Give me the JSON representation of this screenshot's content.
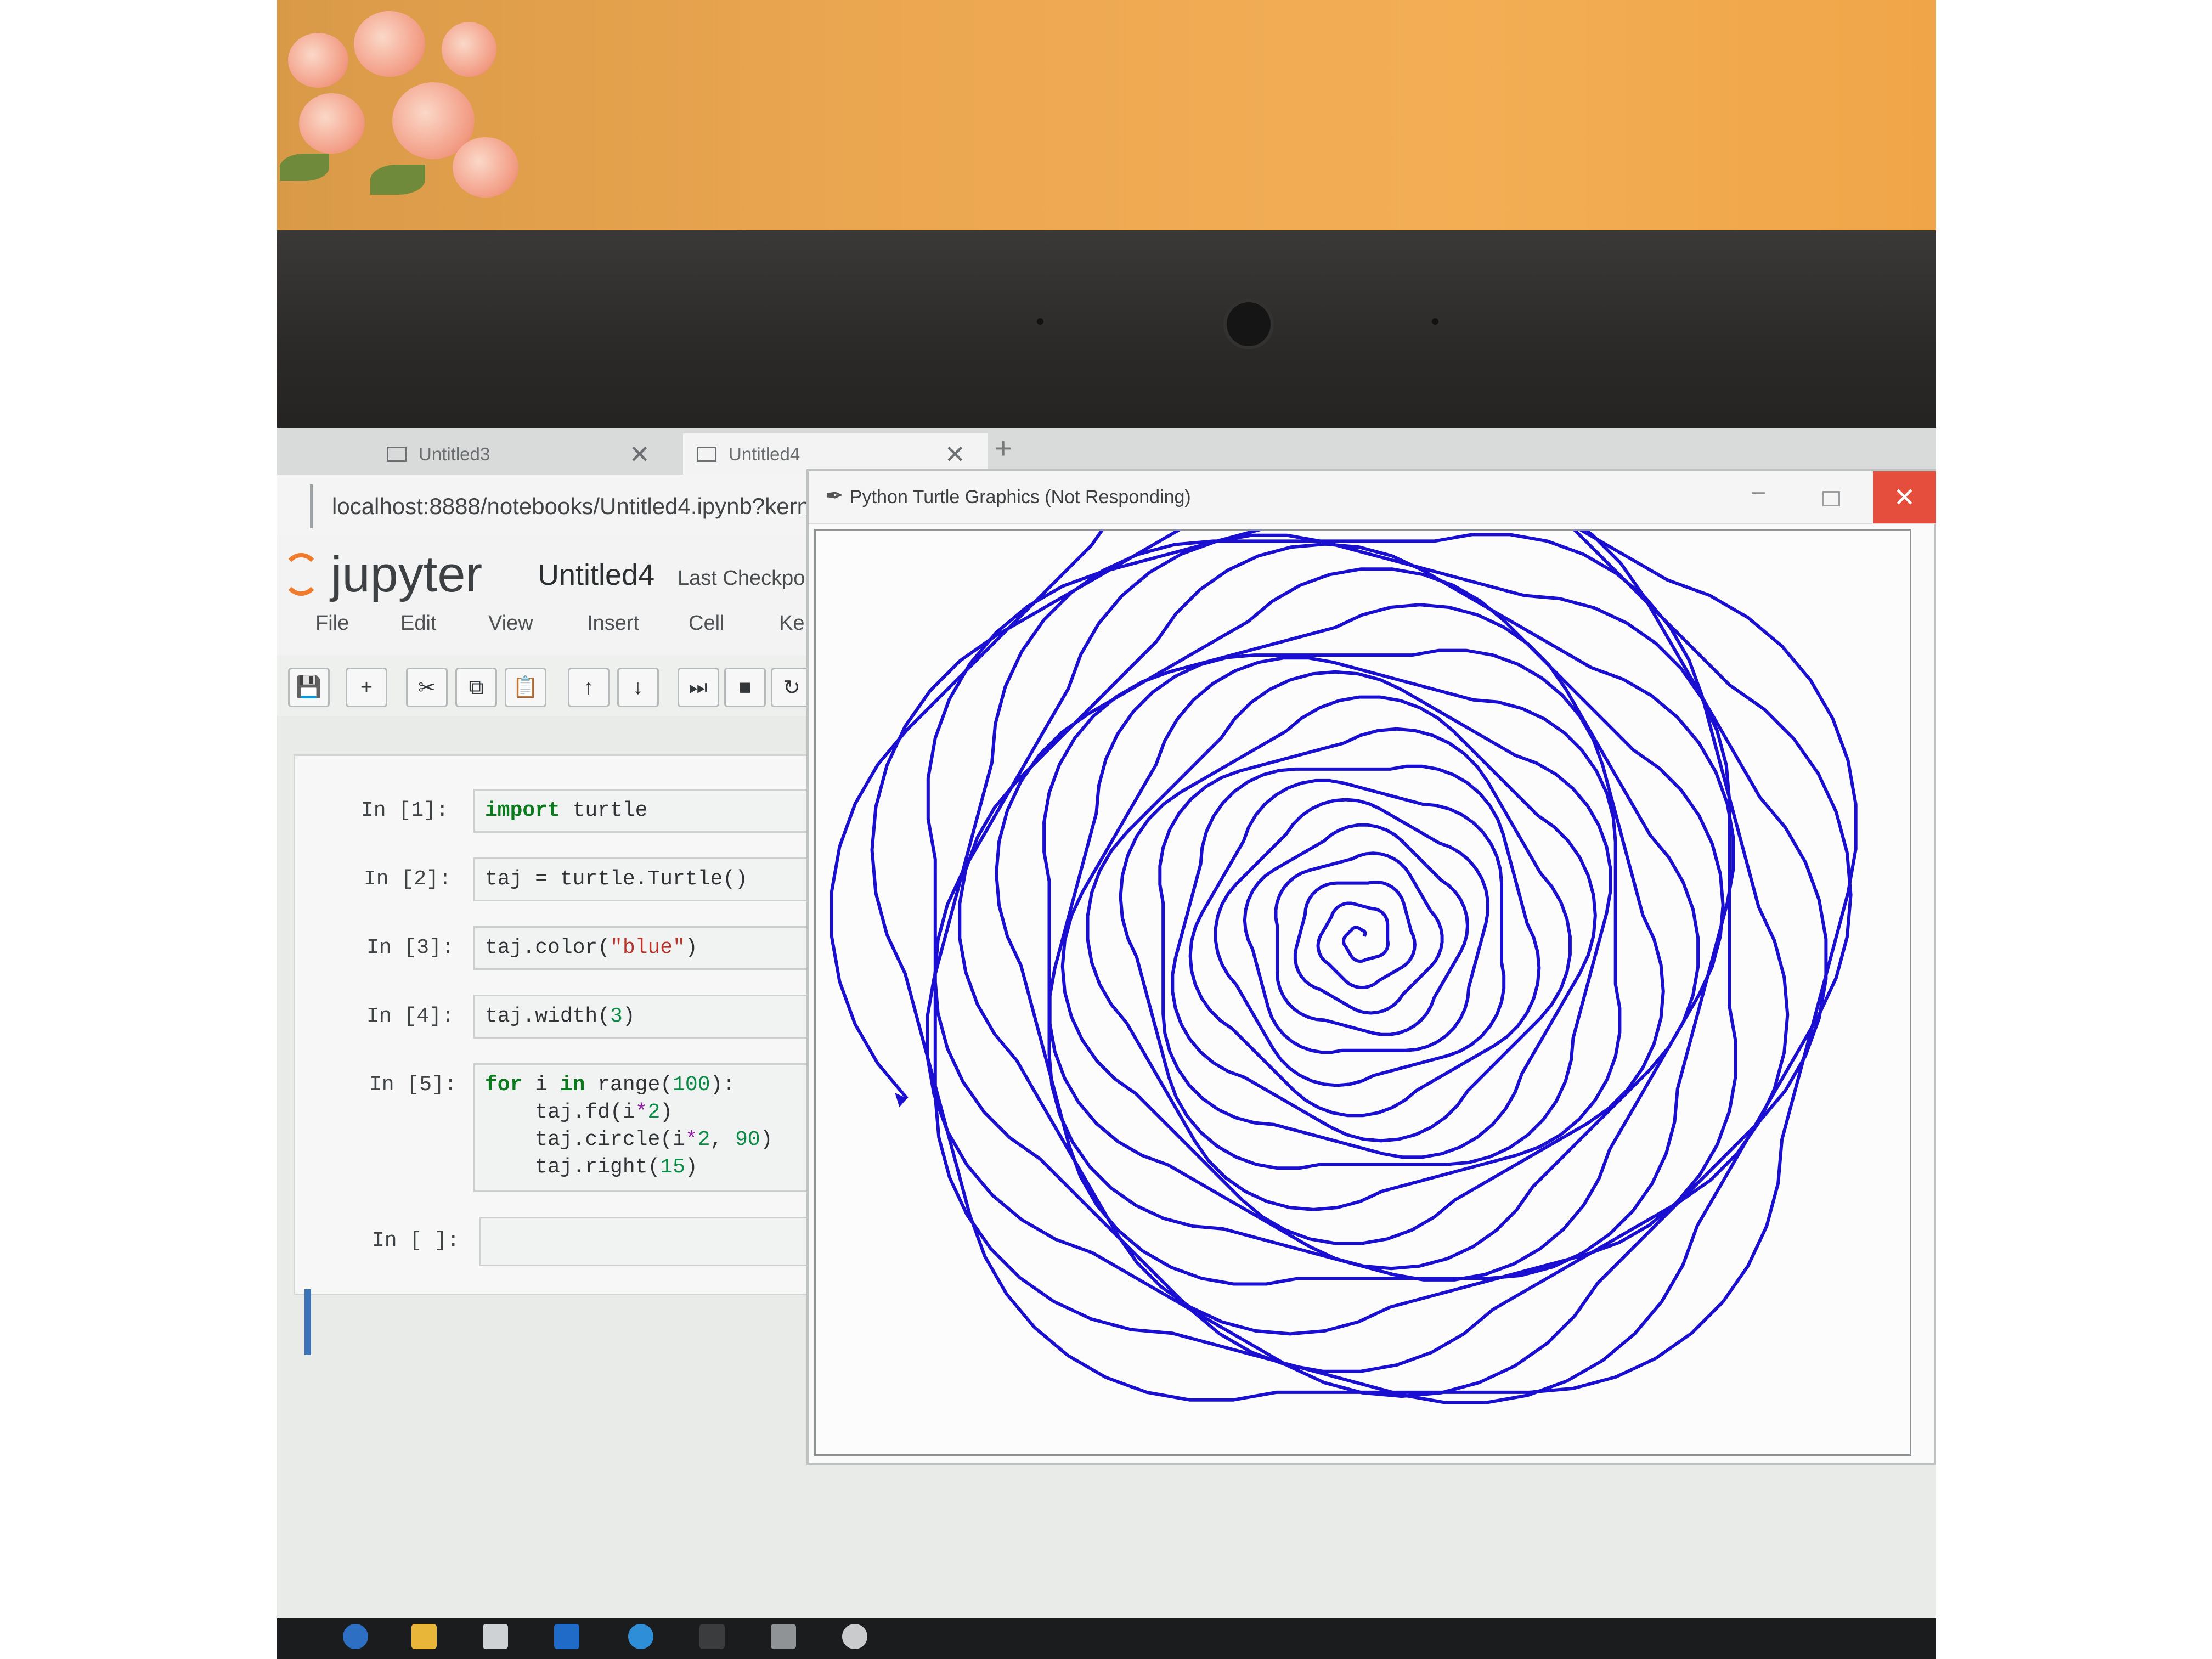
{
  "browser": {
    "tabs": [
      {
        "label": "Untitled3",
        "close": "✕"
      },
      {
        "label": "Untitled4",
        "close": "✕"
      }
    ],
    "new_tab": "+",
    "url": "localhost:8888/notebooks/Untitled4.ipynb?kern"
  },
  "jupyter": {
    "logo_text": "jupyter",
    "notebook_title": "Untitled4",
    "checkpoint": "Last Checkpo",
    "menu": [
      "File",
      "Edit",
      "View",
      "Insert",
      "Cell",
      "Ker"
    ],
    "toolbar": [
      "save-icon",
      "plus-icon",
      "cut-icon",
      "copy-icon",
      "paste-icon",
      "arrow-up-icon",
      "arrow-down-icon",
      "step-forward-icon",
      "stop-icon",
      "restart-icon"
    ],
    "cells": [
      {
        "prompt": "In [1]:"
      },
      {
        "prompt": "In [2]:"
      },
      {
        "prompt": "In [3]:"
      },
      {
        "prompt": "In [4]:"
      },
      {
        "prompt": "In [5]:"
      },
      {
        "prompt": "In [ ]:"
      }
    ]
  },
  "turtle_window": {
    "title": "Python Turtle Graphics (Not Responding)",
    "minimize": "–",
    "close": "✕",
    "stroke_color": "#1a0fd0"
  }
}
